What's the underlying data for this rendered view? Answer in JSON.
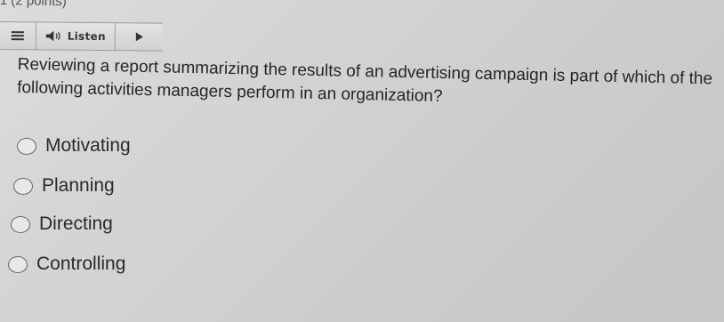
{
  "question": {
    "header_fragment": "1 (2 points)",
    "text": "Reviewing a report summarizing the results of an advertising campaign is part of which of the following activities managers perform in an organization?"
  },
  "toolbar": {
    "menu_icon": "hamburger-menu-icon",
    "speaker_icon": "speaker-icon",
    "listen_label": "Listen",
    "play_icon": "play-icon"
  },
  "options": [
    {
      "label": "Motivating",
      "selected": false
    },
    {
      "label": "Planning",
      "selected": false
    },
    {
      "label": "Directing",
      "selected": false
    },
    {
      "label": "Controlling",
      "selected": false
    }
  ],
  "colors": {
    "background": "#d6d6d6",
    "text": "#262626",
    "radio_border": "#666666"
  }
}
